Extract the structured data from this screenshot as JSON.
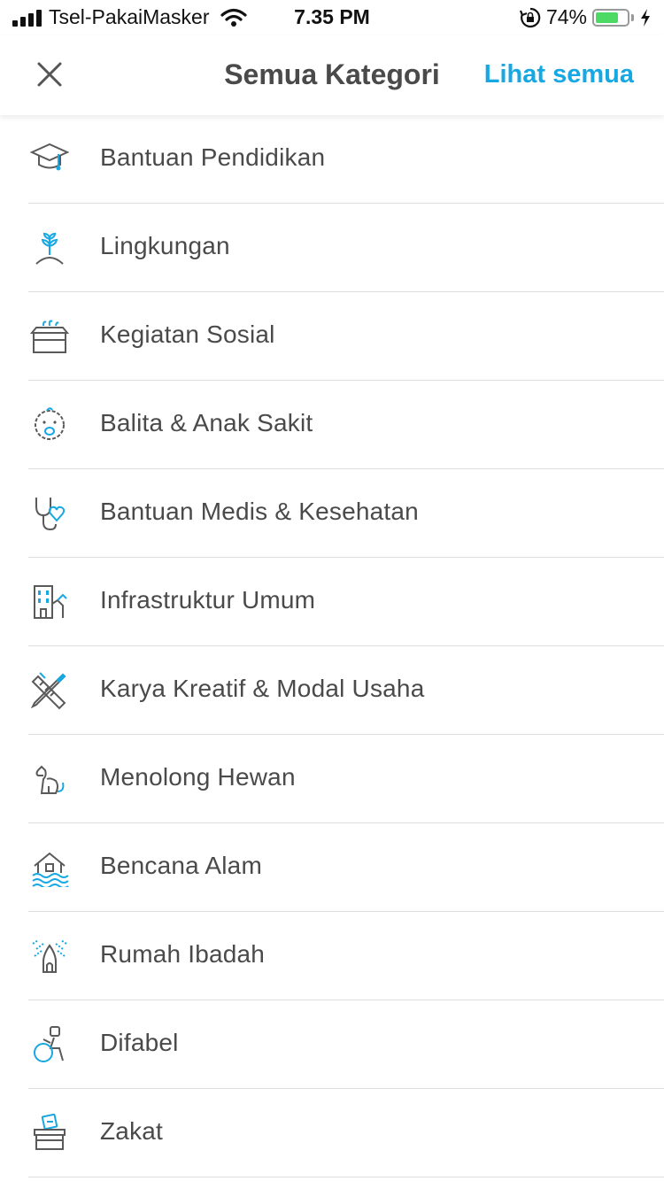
{
  "status_bar": {
    "carrier": "Tsel-PakaiMasker",
    "time": "7.35 PM",
    "battery_percent": "74%",
    "battery_level": 0.74,
    "battery_color": "#4cd964"
  },
  "header": {
    "title": "Semua Kategori",
    "see_all_label": "Lihat semua",
    "accent_color": "#17a8e3",
    "close_icon": "close-icon"
  },
  "categories": [
    {
      "label": "Bantuan Pendidikan",
      "icon": "graduation-cap-icon"
    },
    {
      "label": "Lingkungan",
      "icon": "plant-icon"
    },
    {
      "label": "Kegiatan Sosial",
      "icon": "box-icon"
    },
    {
      "label": "Balita & Anak Sakit",
      "icon": "baby-icon"
    },
    {
      "label": "Bantuan Medis & Kesehatan",
      "icon": "stethoscope-icon"
    },
    {
      "label": "Infrastruktur Umum",
      "icon": "building-icon"
    },
    {
      "label": "Karya Kreatif & Modal Usaha",
      "icon": "pencil-ruler-icon"
    },
    {
      "label": "Menolong Hewan",
      "icon": "dog-icon"
    },
    {
      "label": "Bencana Alam",
      "icon": "flood-house-icon"
    },
    {
      "label": "Rumah Ibadah",
      "icon": "worship-house-icon"
    },
    {
      "label": "Difabel",
      "icon": "wheelchair-icon"
    },
    {
      "label": "Zakat",
      "icon": "donation-box-icon"
    }
  ]
}
